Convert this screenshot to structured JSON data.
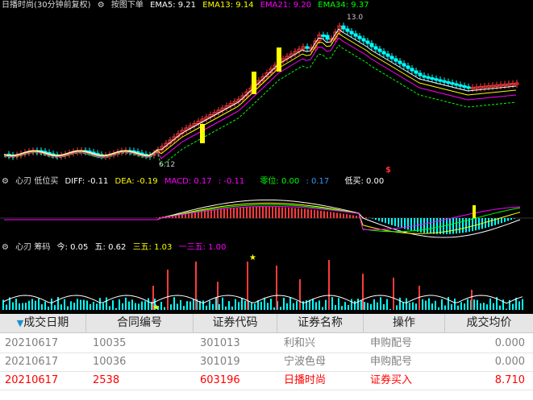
{
  "colors": {
    "up": "#ff3b3b",
    "down": "#00ffff",
    "bg": "#000000",
    "ema5": "#ffffff",
    "ema13": "#ffff00",
    "ema21": "#ff00ff",
    "ema34": "#00ff00",
    "red_text": "#ff0000",
    "gray_text": "#7f7f7f"
  },
  "panel1": {
    "title": "日播时尚(30分钟前复权)",
    "icon": "gear-icon",
    "mode": "按图下单",
    "ema5": "EMA5: 9.21",
    "ema13": "EMA13: 9.14",
    "ema21": "EMA21: 9.20",
    "ema34": "EMA34: 9.37",
    "high_label": "13.0",
    "low_label": "6.12",
    "marker": "$"
  },
  "panel2": {
    "name": "心刃 低位买",
    "diff": "DIFF: -0.11",
    "dea": "DEA: -0.19",
    "macd": "MACD: 0.17",
    "macd2": ": -0.11",
    "zero": "零位: 0.00",
    "val": ": 0.17",
    "lowbuy": "低买: 0.00"
  },
  "panel3": {
    "name": "心刃 筹码",
    "jin": "今: 0.05",
    "wu": "五: 0.62",
    "sanwu": "三五: 1.03",
    "ysanwu": "一三五: 1.00"
  },
  "table": {
    "headers": [
      "成交日期",
      "合同编号",
      "证券代码",
      "证券名称",
      "操作",
      "成交均价"
    ],
    "rows": [
      [
        "20210617",
        "10035",
        "301013",
        "利和兴",
        "申购配号",
        "0.000"
      ],
      [
        "20210617",
        "10036",
        "301019",
        "宁波色母",
        "申购配号",
        "0.000"
      ],
      [
        "20210617",
        "2538",
        "603196",
        "日播时尚",
        "证券买入",
        "8.710"
      ]
    ]
  }
}
